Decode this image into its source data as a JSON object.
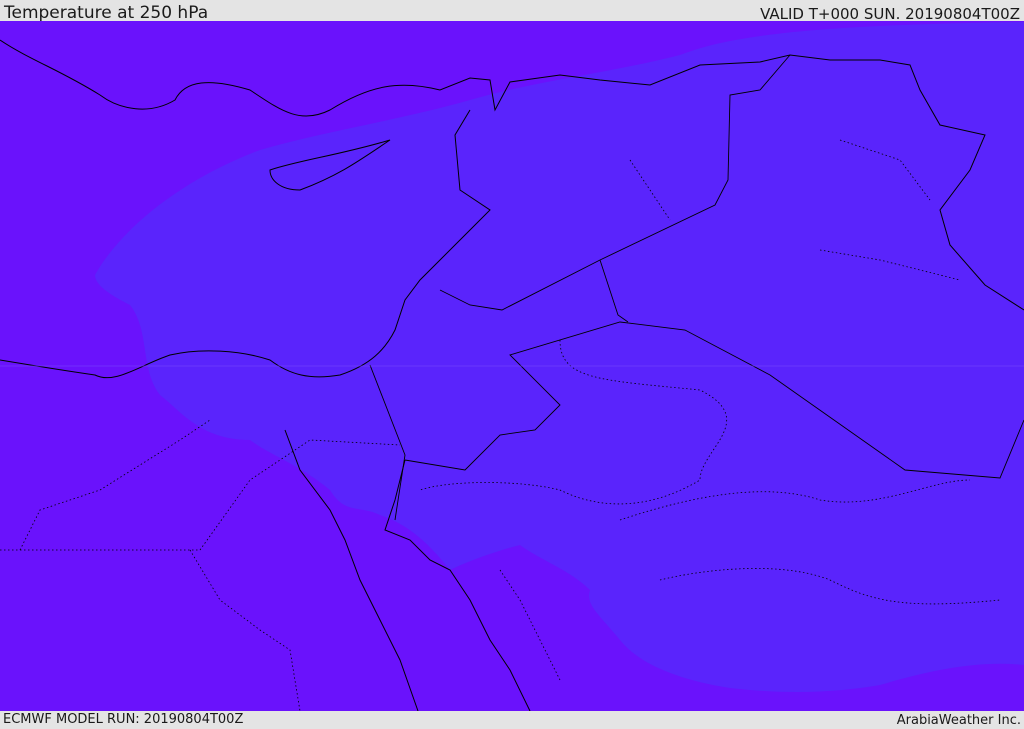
{
  "header": {
    "title": "Temperature at 250 hPa",
    "valid": "VALID T+000 SUN. 20190804T00Z"
  },
  "footer": {
    "model_run": "ECMWF MODEL RUN: 20190804T00Z",
    "brand": "ArabiaWeather Inc."
  },
  "colors": {
    "outer_field": "#6a12fc",
    "inner_field": "#5a24fc",
    "border": "#000000"
  }
}
